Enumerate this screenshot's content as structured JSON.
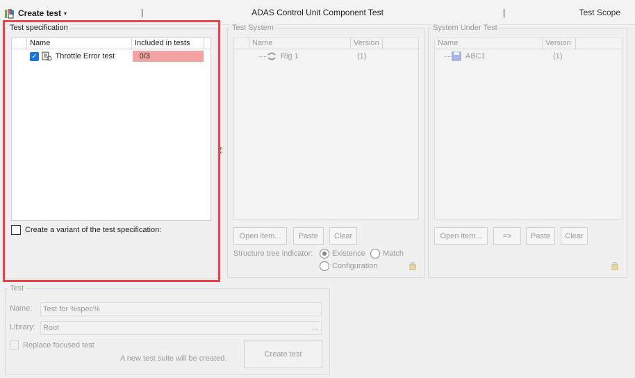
{
  "toolbar": {
    "create_test_label": "Create test",
    "title": "ADAS Control Unit Component Test",
    "scope": "Test Scope"
  },
  "spec": {
    "title": "Test specification",
    "col_name": "Name",
    "col_included": "Included in tests",
    "row_name": "Throttle Error test",
    "row_included": "0/3",
    "variant_label": "Create a variant of the test specification:"
  },
  "system": {
    "title": "Test System",
    "col_name": "Name",
    "col_version": "Version",
    "row_name": "Rig 1",
    "row_version": "(1)",
    "btn_open": "Open item...",
    "btn_paste": "Paste",
    "btn_clear": "Clear",
    "indicator_label": "Structure tree indicator:",
    "opt_existence": "Existence",
    "opt_match": "Match",
    "opt_configuration": "Configuration"
  },
  "sut": {
    "title": "System Under Test",
    "col_name": "Name",
    "col_version": "Version",
    "row_name": "ABC1",
    "row_version": "(1)",
    "btn_open": "Open item...",
    "btn_arrow": "=>",
    "btn_paste": "Paste",
    "btn_clear": "Clear"
  },
  "test": {
    "title": "Test",
    "name_label": "Name:",
    "name_value": "Test for %spec%",
    "library_label": "Library:",
    "library_value": "Root",
    "library_browse": "...",
    "replace_label": "Replace focused test",
    "notice": "A new test suite will be created.",
    "create_btn": "Create test"
  }
}
